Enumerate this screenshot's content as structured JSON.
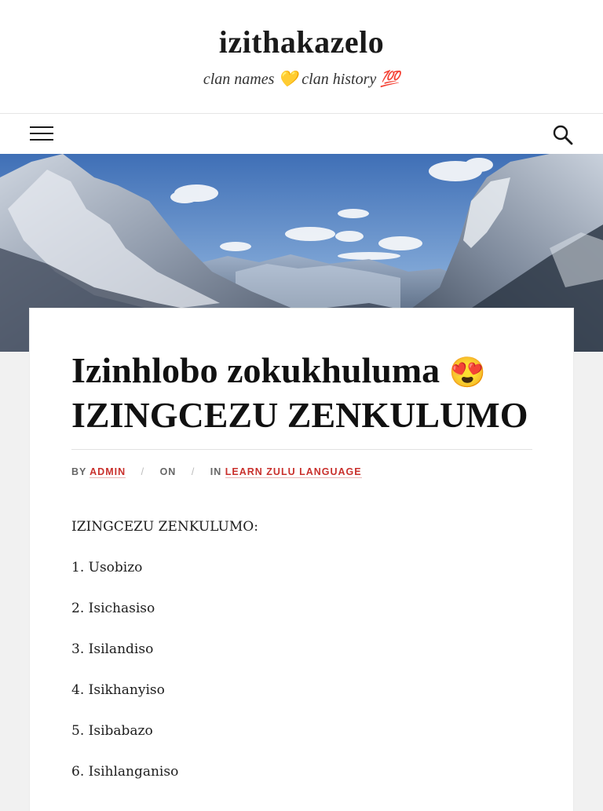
{
  "site": {
    "title": "izithakazelo",
    "tagline": "clan names 💛 clan history 💯"
  },
  "nav": {
    "menu_icon": "hamburger-menu-icon",
    "search_icon": "search-icon"
  },
  "hero": {
    "image": "snowy-mountain-landscape"
  },
  "post": {
    "title_line1": "Izinhlobo zokukhuluma",
    "title_emoji": "😍",
    "title_line2": "IZINGCEZU ZENKULUMO",
    "meta": {
      "by_label": "BY",
      "author": "ADMIN",
      "separator": "/",
      "on_label": "ON",
      "in_label": "IN",
      "category": "LEARN ZULU LANGUAGE"
    },
    "body": [
      "IZINGCEZU ZENKULUMO:",
      "1. Usobizo",
      "2. Isichasiso",
      "3. Isilandiso",
      "4. Isikhanyiso",
      "5. Isibabazo",
      "6. Isihlanganiso"
    ]
  },
  "colors": {
    "accent": "#c9302c",
    "page_bg": "#f1f1f1",
    "card_bg": "#ffffff"
  }
}
